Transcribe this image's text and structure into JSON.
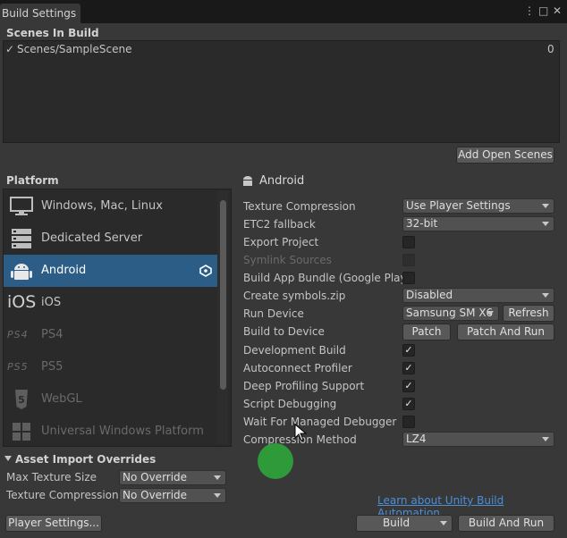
{
  "window": {
    "tab_title": "Build Settings",
    "menu_glyph": "⋮",
    "maximize_glyph": "□",
    "close_glyph": "✕"
  },
  "scenes": {
    "header": "Scenes In Build",
    "items": [
      {
        "check": "✓",
        "name": "Scenes/SampleScene",
        "index": "0"
      }
    ],
    "add_open_scenes": "Add Open Scenes"
  },
  "platform": {
    "header": "Platform",
    "items": [
      {
        "label": "Windows, Mac, Linux",
        "icon": "monitor-icon"
      },
      {
        "label": "Dedicated Server",
        "icon": "server-icon"
      },
      {
        "label": "Android",
        "icon": "android-icon",
        "selected": true,
        "badge": "unity-icon"
      },
      {
        "label": "iOS",
        "icon": "ios-icon",
        "icon_text": "iOS"
      },
      {
        "label": "PS4",
        "icon": "ps4-icon",
        "icon_text": "PS4",
        "dim": true
      },
      {
        "label": "PS5",
        "icon": "ps5-icon",
        "icon_text": "PS5",
        "dim": true
      },
      {
        "label": "WebGL",
        "icon": "html5-icon",
        "dim": true
      },
      {
        "label": "Universal Windows Platform",
        "icon": "windows-icon",
        "dim": true
      }
    ]
  },
  "android": {
    "title": "Android",
    "texture_compression": {
      "label": "Texture Compression",
      "value": "Use Player Settings"
    },
    "etc2_fallback": {
      "label": "ETC2 fallback",
      "value": "32-bit"
    },
    "export_project": {
      "label": "Export Project"
    },
    "symlink_sources": {
      "label": "Symlink Sources"
    },
    "build_app_bundle": {
      "label": "Build App Bundle (Google Play)"
    },
    "create_symbols_zip": {
      "label": "Create symbols.zip",
      "value": "Disabled"
    },
    "run_device": {
      "label": "Run Device",
      "value": "Samsung SM X6",
      "refresh": "Refresh"
    },
    "build_to_device": {
      "label": "Build to Device",
      "patch": "Patch",
      "patch_and_run": "Patch And Run"
    },
    "development_build": {
      "label": "Development Build",
      "check": "✓"
    },
    "autoconnect_profiler": {
      "label": "Autoconnect Profiler",
      "check": "✓"
    },
    "deep_profiling": {
      "label": "Deep Profiling Support",
      "check": "✓"
    },
    "script_debugging": {
      "label": "Script Debugging",
      "check": "✓"
    },
    "wait_for_debugger": {
      "label": "Wait For Managed Debugger"
    },
    "compression_method": {
      "label": "Compression Method",
      "value": "LZ4"
    }
  },
  "asset_import": {
    "header": "Asset Import Overrides",
    "max_texture_size": {
      "label": "Max Texture Size",
      "value": "No Override"
    },
    "texture_compression": {
      "label": "Texture Compression",
      "value": "No Override"
    }
  },
  "footer": {
    "player_settings": "Player Settings...",
    "learn_link": "Learn about Unity Build Automation",
    "build": "Build",
    "build_and_run": "Build And Run"
  }
}
